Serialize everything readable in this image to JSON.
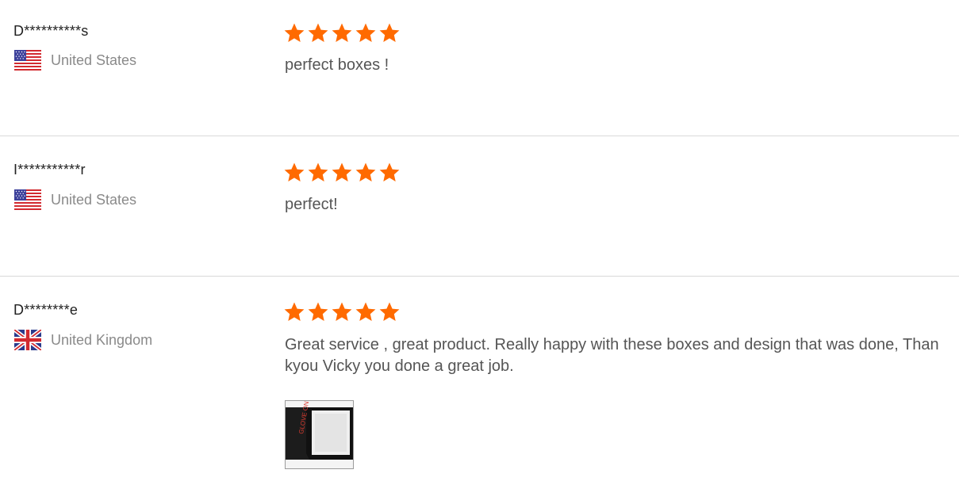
{
  "reviews": [
    {
      "reviewer": "D**********s",
      "country": "United States",
      "flag_icon": "us-flag-icon",
      "rating": 5,
      "rating_max": 5,
      "text": "perfect boxes !"
    },
    {
      "reviewer": "I***********r",
      "country": "United States",
      "flag_icon": "us-flag-icon",
      "rating": 5,
      "rating_max": 5,
      "text": "perfect!"
    },
    {
      "reviewer": "D********e",
      "country": "United Kingdom",
      "flag_icon": "uk-flag-icon",
      "rating": 5,
      "rating_max": 5,
      "text": "Great service , great product. Really happy with these boxes and design that was done, Than kyou Vicky you done a great job.",
      "has_photo": true
    }
  ],
  "colors": {
    "star": "#ff6a00",
    "divider": "#d9d9d9",
    "reviewer_text": "#222222",
    "country_text": "#8a8a8a",
    "review_text": "#555555"
  }
}
